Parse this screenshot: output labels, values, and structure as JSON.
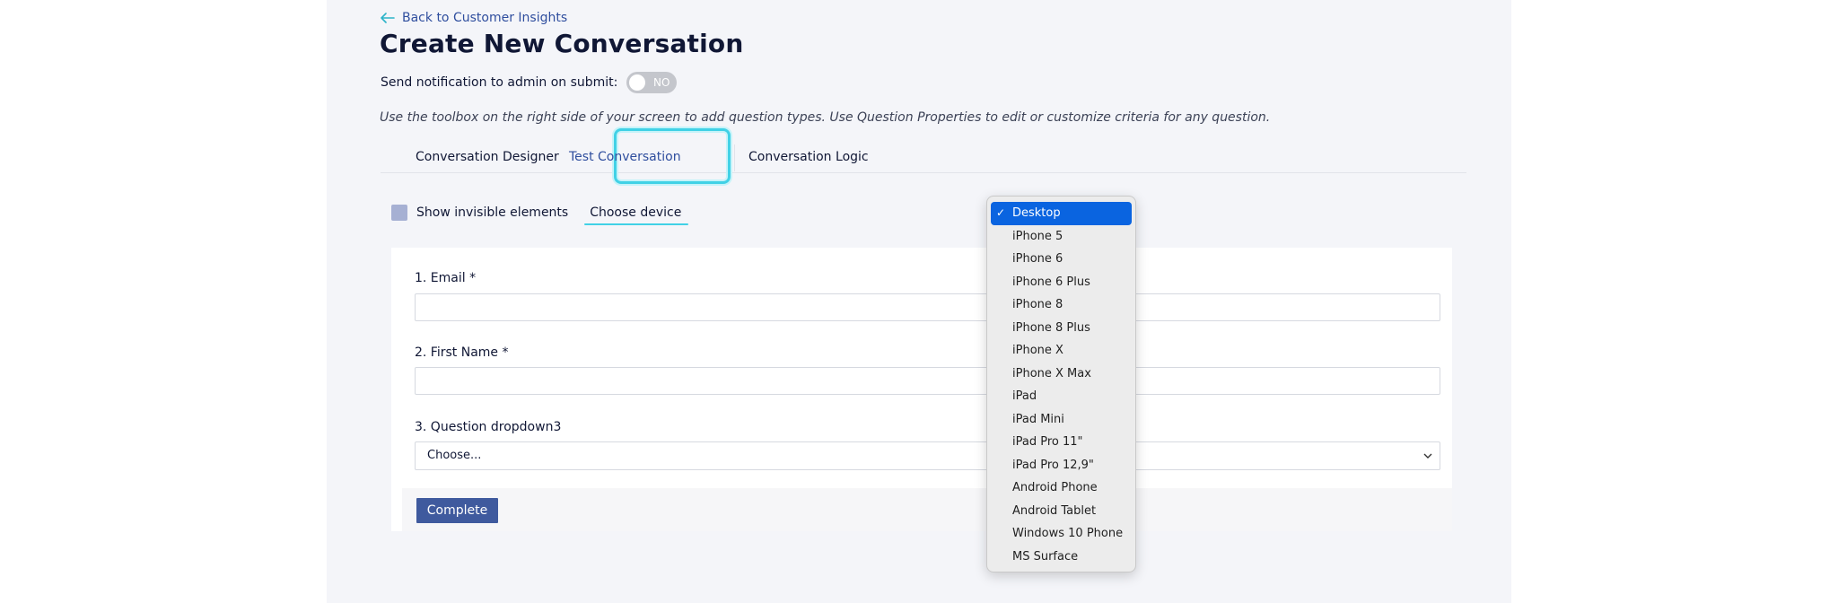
{
  "header": {
    "back_link": "Back to Customer Insights",
    "title": "Create New Conversation",
    "notification_label": "Send notification to admin on submit:",
    "toggle_text": "NO",
    "hint": "Use the toolbox on the right side of your screen to add question types. Use Question Properties to edit or customize criteria for any question."
  },
  "tabs": [
    {
      "label": "Conversation Designer"
    },
    {
      "label": "Test Conversation"
    },
    {
      "label": "Conversation Logic"
    }
  ],
  "options": {
    "show_invisible_label": "Show invisible elements",
    "choose_device_label": "Choose device"
  },
  "form": {
    "questions": [
      {
        "label": "1. Email *"
      },
      {
        "label": "2. First Name *"
      },
      {
        "label": "3. Question dropdown3",
        "placeholder": "Choose..."
      }
    ],
    "complete_label": "Complete"
  },
  "device_dropdown": {
    "selected": "Desktop",
    "items": [
      "Desktop",
      "iPhone 5",
      "iPhone 6",
      "iPhone 6 Plus",
      "iPhone 8",
      "iPhone 8 Plus",
      "iPhone X",
      "iPhone X Max",
      "iPad",
      "iPad Mini",
      "iPad Pro 11\"",
      "iPad Pro 12,9\"",
      "Android Phone",
      "Android Tablet",
      "Windows 10 Phone",
      "MS Surface"
    ]
  },
  "colors": {
    "accent": "#2f4e9e",
    "focus_ring": "#41d1e6",
    "button": "#3f5a9e",
    "dropdown_selected": "#0a64e0"
  }
}
